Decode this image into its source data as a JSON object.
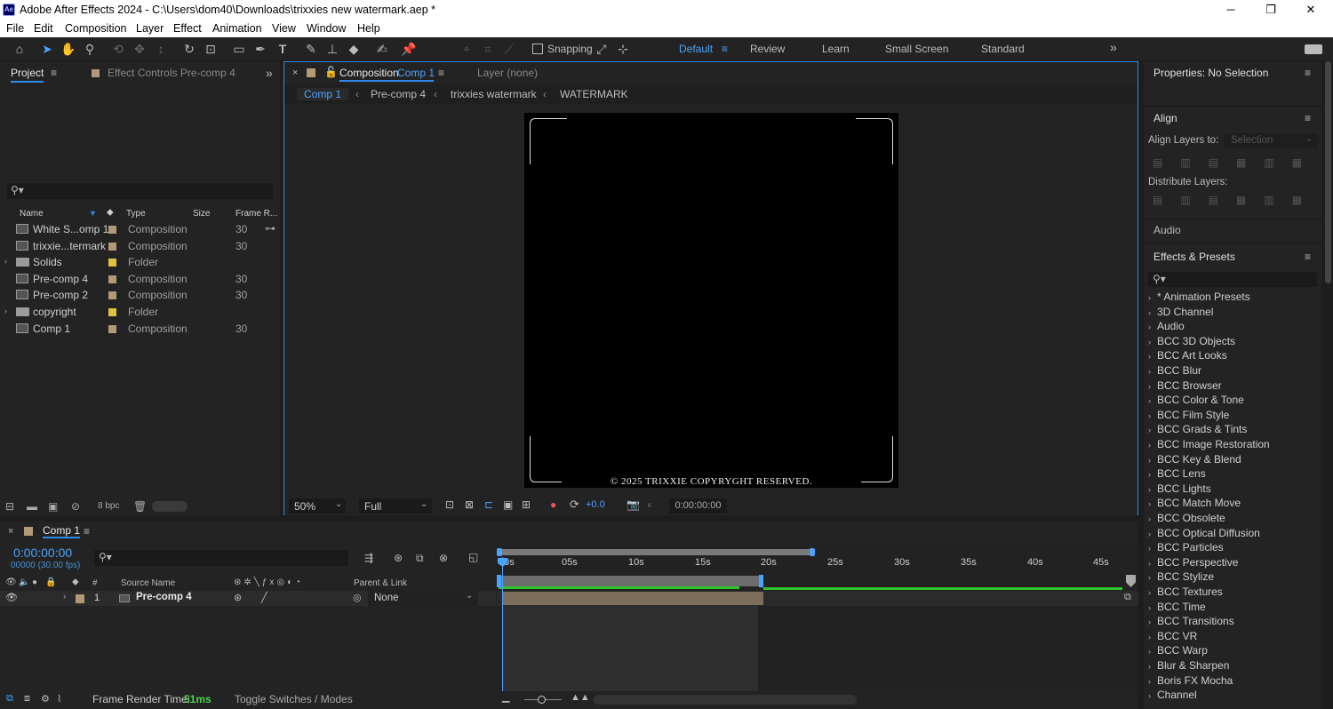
{
  "window": {
    "title": "Adobe After Effects 2024 - C:\\Users\\dom40\\Downloads\\trixxies new watermark.aep *",
    "app_icon": "Ae",
    "minimize": "─",
    "maximize": "❐",
    "close": "✕"
  },
  "menu": [
    "File",
    "Edit",
    "Composition",
    "Layer",
    "Effect",
    "Animation",
    "View",
    "Window",
    "Help"
  ],
  "toolbar": {
    "snapping": "Snapping",
    "workspaces": [
      "Default",
      "Review",
      "Learn",
      "Small Screen",
      "Standard"
    ],
    "more": "»"
  },
  "project_panel": {
    "tab_project": "Project",
    "tab_effect_controls": "Effect Controls Pre-comp 4",
    "search_placeholder": "",
    "columns": {
      "name": "Name",
      "type": "Type",
      "size": "Size",
      "frame_rate": "Frame R..."
    },
    "items": [
      {
        "name": "White S...omp 1",
        "type": "Composition",
        "frame_rate": "30",
        "kind": "comp"
      },
      {
        "name": "trixxie...termark",
        "type": "Composition",
        "frame_rate": "30",
        "kind": "comp"
      },
      {
        "name": "Solids",
        "type": "Folder",
        "frame_rate": "",
        "kind": "folder"
      },
      {
        "name": "Pre-comp 4",
        "type": "Composition",
        "frame_rate": "30",
        "kind": "comp"
      },
      {
        "name": "Pre-comp 2",
        "type": "Composition",
        "frame_rate": "30",
        "kind": "comp"
      },
      {
        "name": "copyright",
        "type": "Folder",
        "frame_rate": "",
        "kind": "folder"
      },
      {
        "name": "Comp 1",
        "type": "Composition",
        "frame_rate": "30",
        "kind": "comp"
      }
    ],
    "bpc": "8 bpc"
  },
  "composition_panel": {
    "tab_prefix": "Composition",
    "tab_comp": "Comp 1",
    "layer_tab": "Layer  (none)",
    "breadcrumbs": [
      "Comp 1",
      "Pre-comp 4",
      "trixxies watermark",
      "WATERMARK"
    ],
    "watermark_text": "© 2025 TRIXXIE COPYRYGHT RESERVED.",
    "zoom": "50%",
    "resolution": "Full",
    "exposure": "+0.0",
    "timecode": "0:00:00:00"
  },
  "properties_panel": {
    "title": "Properties: No Selection",
    "align_title": "Align",
    "align_layers_to": "Align Layers to:",
    "align_target": "Selection",
    "distribute_layers": "Distribute Layers:",
    "audio_title": "Audio",
    "effects_title": "Effects & Presets",
    "effects": [
      "* Animation Presets",
      "3D Channel",
      "Audio",
      "BCC 3D Objects",
      "BCC Art Looks",
      "BCC Blur",
      "BCC Browser",
      "BCC Color & Tone",
      "BCC Film Style",
      "BCC Grads & Tints",
      "BCC Image Restoration",
      "BCC Key & Blend",
      "BCC Lens",
      "BCC Lights",
      "BCC Match Move",
      "BCC Obsolete",
      "BCC Optical Diffusion",
      "BCC Particles",
      "BCC Perspective",
      "BCC Stylize",
      "BCC Textures",
      "BCC Time",
      "BCC Transitions",
      "BCC VR",
      "BCC Warp",
      "Blur & Sharpen",
      "Boris FX Mocha",
      "Channel"
    ]
  },
  "timeline": {
    "tab": "Comp 1",
    "timecode": "0:00:00:00",
    "frame_info": "00000 (30.00 fps)",
    "col_hash": "#",
    "col_source": "Source Name",
    "col_parent": "Parent & Link",
    "ruler": [
      "00s",
      "05s",
      "10s",
      "15s",
      "20s",
      "25s",
      "30s",
      "35s",
      "40s",
      "45s"
    ],
    "layer": {
      "index": "1",
      "name": "Pre-comp 4",
      "parent": "None"
    },
    "frame_render_label": "Frame Render Time:",
    "frame_render_value": "51ms",
    "toggle_label": "Toggle Switches / Modes"
  },
  "colors": {
    "accent": "#2d8ceb",
    "comp_swatch": "#b39a77",
    "folder_swatch": "#e0c33d",
    "layer_bar": "#7d6e5b",
    "work_area_green": "#2ec52e"
  }
}
